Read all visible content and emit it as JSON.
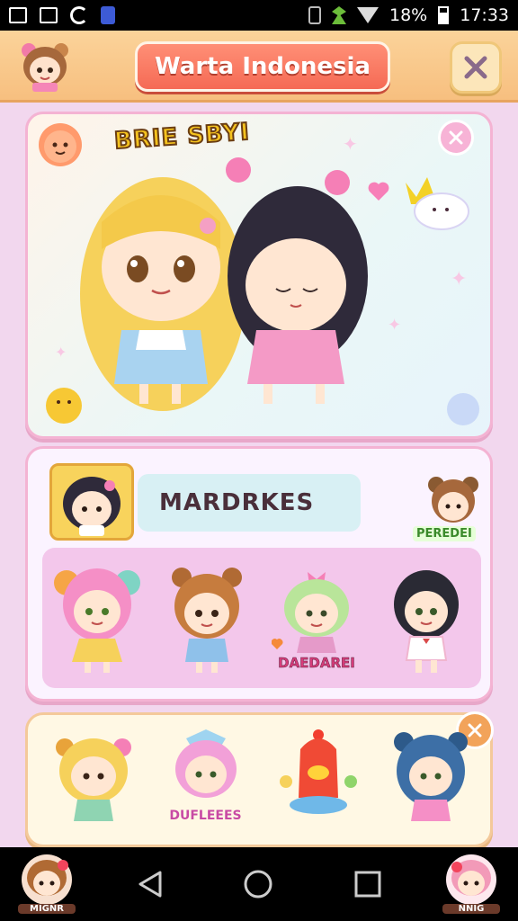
{
  "status_bar": {
    "battery": "18%",
    "time": "17:33"
  },
  "header": {
    "title": "Warta Indonesia"
  },
  "hero": {
    "title": "BRIE SBYI"
  },
  "panel": {
    "marker_label": "MARDRKES",
    "side_label": "PEREDEI",
    "characters": [
      {
        "label": ""
      },
      {
        "label": ""
      },
      {
        "label": "DAEDAREI"
      },
      {
        "label": ""
      }
    ]
  },
  "bottom": {
    "characters": [
      {
        "label": ""
      },
      {
        "label": "DUFLEEES"
      },
      {
        "label": ""
      },
      {
        "label": ""
      }
    ]
  },
  "nav": {
    "left_avatar_caption": "MIGNR",
    "right_avatar_caption": "NNIG"
  },
  "colors": {
    "header": "#f7bf7f",
    "title_pill": "#f56a55",
    "card_border": "#f4b3d3",
    "panel_grid": "#f3c7eb"
  }
}
